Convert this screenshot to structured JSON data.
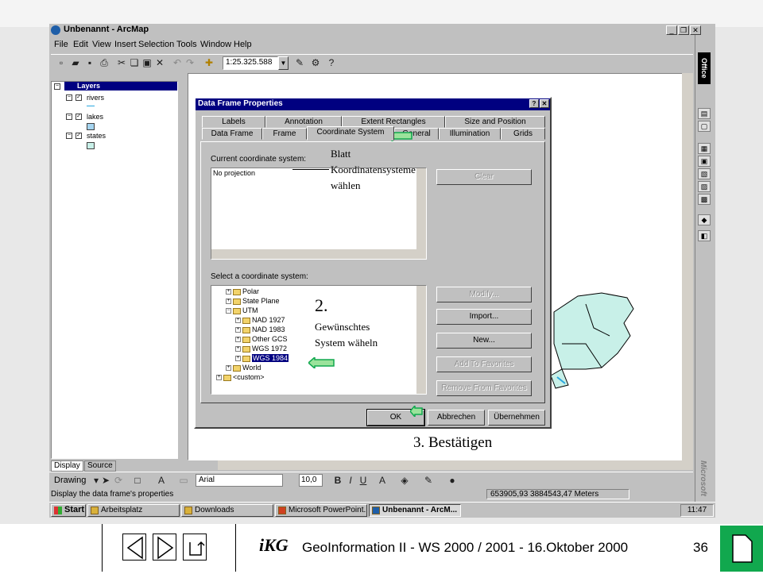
{
  "window": {
    "title": "Unbenannt - ArcMap"
  },
  "menu": [
    {
      "label": "File",
      "u": "F"
    },
    {
      "label": "Edit",
      "u": "E"
    },
    {
      "label": "View",
      "u": "V"
    },
    {
      "label": "Insert",
      "u": "I"
    },
    {
      "label": "Selection",
      "u": "S"
    },
    {
      "label": "Tools",
      "u": "T"
    },
    {
      "label": "Window",
      "u": "W"
    },
    {
      "label": "Help",
      "u": "H"
    }
  ],
  "toolbar": {
    "scale": "1:25.325.588"
  },
  "toc": {
    "root": "Layers",
    "layers": [
      "rivers",
      "lakes",
      "states"
    ],
    "tabs": [
      "Display",
      "Source"
    ]
  },
  "office_bar": {
    "label": "Office",
    "brand": "Microsoft"
  },
  "drawing": {
    "label": "Drawing",
    "font": "Arial",
    "size": "10,0"
  },
  "status": {
    "message": "Display the data frame's properties",
    "coords": "653905,93  3884543,47 Meters"
  },
  "taskbar": {
    "start": "Start",
    "tasks": [
      "Arbeitsplatz",
      "Downloads",
      "Microsoft PowerPoint...",
      "Unbenannt - ArcM..."
    ],
    "clock": "11:47"
  },
  "dialog": {
    "title": "Data Frame Properties",
    "tabs_row1": [
      "Labels",
      "Annotation",
      "Extent Rectangles",
      "Size and Position"
    ],
    "tabs_row2": [
      "Data Frame",
      "Frame",
      "Coordinate System",
      "General",
      "Illumination",
      "Grids"
    ],
    "current_label": "Current coordinate system:",
    "current_value": "No projection",
    "select_label": "Select a coordinate system:",
    "tree": [
      "Polar",
      "State Plane",
      "UTM",
      "NAD 1927",
      "NAD 1983",
      "Other GCS",
      "WGS 1972",
      "WGS 1984",
      "World",
      "<custom>"
    ],
    "buttons": {
      "clear": "Clear",
      "modify": "Modify...",
      "import": "Import...",
      "new": "New...",
      "add_fav": "Add To Favorites",
      "remove_fav": "Remove From Favorites",
      "ok": "OK",
      "cancel": "Abbrechen",
      "apply": "Übernehmen"
    }
  },
  "annotations": {
    "step1_line1": "Blatt",
    "step1_line2": "Koordinatensysteme",
    "step1_line3": "wählen",
    "step2_num": "2.",
    "step2_line1": "Gewünschtes",
    "step2_line2": "System wäheln",
    "step3": "3. Bestätigen"
  },
  "footer": {
    "text": "GeoInformation II - WS 2000 / 2001 - 16.Oktober 2000",
    "page": "36",
    "logo": "iKG"
  },
  "colors": {
    "accent_green": "#11a84e",
    "titlebar_blue": "#000080",
    "map_fill": "#c8f0e8"
  }
}
